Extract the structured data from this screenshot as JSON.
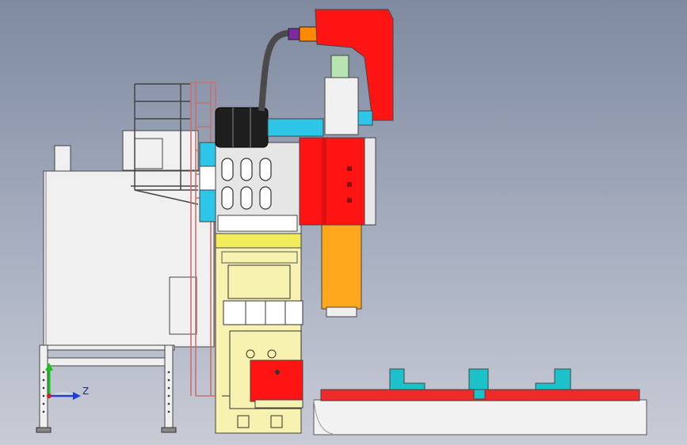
{
  "viewport": {
    "background_top": "#7f8aa0",
    "background_bottom": "#c9ccd6"
  },
  "axis_triad": {
    "z_label": "Z",
    "z_color": "#1f3fd0",
    "y_color": "#16c21a",
    "x_color": "#d01f1f"
  },
  "palette": {
    "cabinet": "#f0f0f0",
    "column": "#f7f2b0",
    "column_top": "#f2ec5a",
    "head": "#ff1414",
    "spindle": "#ffa81e",
    "table": "#ee2a2a",
    "fixture": "#1cc2c9",
    "motor": "#b7e4b0",
    "tires": "#1e1e1e",
    "panel_cyan": "#2ec6e8",
    "ladder": "#c87070",
    "hose": "#4a4a4a",
    "coupler": "#7a2c9e",
    "orange_block": "#ff8a00"
  }
}
